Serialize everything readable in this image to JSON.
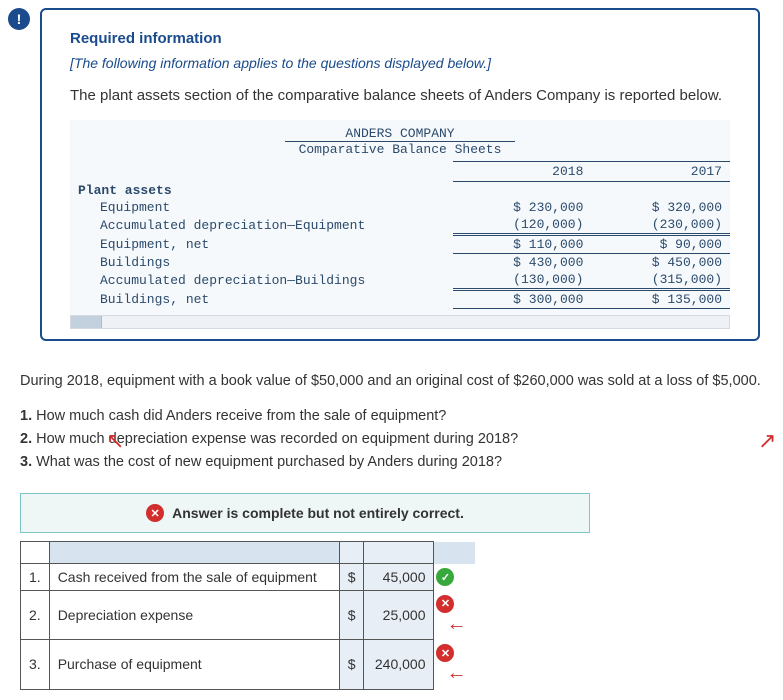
{
  "alert_icon_glyph": "!",
  "required": {
    "title": "Required information",
    "subtitle": "[The following information applies to the questions displayed below.]",
    "intro": "The plant assets section of the comparative balance sheets of Anders Company is reported below."
  },
  "sheet": {
    "company": "ANDERS COMPANY",
    "title": "Comparative Balance Sheets",
    "year1": "2018",
    "year2": "2017",
    "section": "Plant assets",
    "rows": {
      "equipment": {
        "label": "Equipment",
        "v1": "$ 230,000",
        "v2": "$ 320,000"
      },
      "accdep_eq": {
        "label": "Accumulated depreciation—Equipment",
        "v1": "(120,000)",
        "v2": "(230,000)"
      },
      "eq_net": {
        "label": "Equipment, net",
        "v1": "$ 110,000",
        "v2": "$  90,000"
      },
      "buildings": {
        "label": "Buildings",
        "v1": "$ 430,000",
        "v2": "$ 450,000"
      },
      "accdep_bl": {
        "label": "Accumulated depreciation—Buildings",
        "v1": "(130,000)",
        "v2": "(315,000)"
      },
      "bl_net": {
        "label": "Buildings, net",
        "v1": "$ 300,000",
        "v2": "$ 135,000"
      }
    }
  },
  "narrative": "During 2018, equipment with a book value of $50,000 and an original cost of $260,000 was sold at a loss of $5,000.",
  "questions": {
    "q1": {
      "num": "1.",
      "text": "How much cash did Anders receive from the sale of equipment?"
    },
    "q2": {
      "num": "2.",
      "text": "How much depreciation expense was recorded on equipment during 2018?"
    },
    "q3": {
      "num": "3.",
      "text": "What was the cost of new equipment purchased by Anders during 2018?"
    }
  },
  "feedback": {
    "icon": "✕",
    "text": "Answer is complete but not entirely correct."
  },
  "answers": {
    "r1": {
      "num": "1.",
      "desc": "Cash received from the sale of equipment",
      "cur": "$",
      "val": "45,000",
      "mark": "check"
    },
    "r2": {
      "num": "2.",
      "desc": "Depreciation expense",
      "cur": "$",
      "val": "25,000",
      "mark": "cross"
    },
    "r3": {
      "num": "3.",
      "desc": "Purchase of equipment",
      "cur": "$",
      "val": "240,000",
      "mark": "cross"
    }
  }
}
